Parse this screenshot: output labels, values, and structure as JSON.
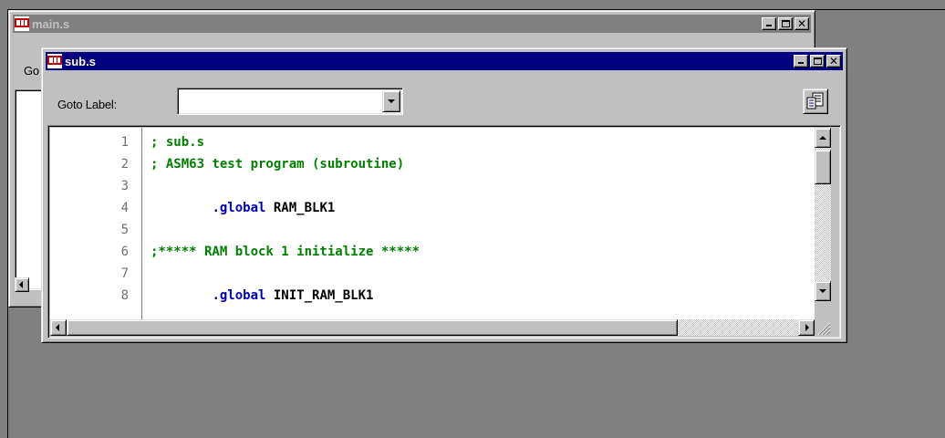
{
  "main_window": {
    "title": "main.s",
    "goto_label_truncated": "Go"
  },
  "sub_window": {
    "title": "sub.s",
    "goto_label": "Goto Label:",
    "goto_value": "",
    "code_lines": [
      {
        "num": "1",
        "segments": [
          {
            "text": "; sub.s",
            "kind": "comment"
          }
        ]
      },
      {
        "num": "2",
        "segments": [
          {
            "text": "; ASM63 test program (subroutine)",
            "kind": "comment"
          }
        ]
      },
      {
        "num": "3",
        "segments": []
      },
      {
        "num": "4",
        "segments": [
          {
            "text": "        ",
            "kind": "text"
          },
          {
            "text": ".global",
            "kind": "directive"
          },
          {
            "text": " RAM_BLK1",
            "kind": "text"
          }
        ]
      },
      {
        "num": "5",
        "segments": []
      },
      {
        "num": "6",
        "segments": [
          {
            "text": ";***** RAM block 1 initialize *****",
            "kind": "comment"
          }
        ]
      },
      {
        "num": "7",
        "segments": []
      },
      {
        "num": "8",
        "segments": [
          {
            "text": "        ",
            "kind": "text"
          },
          {
            "text": ".global",
            "kind": "directive"
          },
          {
            "text": " INIT_RAM_BLK1",
            "kind": "text"
          }
        ]
      }
    ]
  },
  "colors": {
    "active_title": "#000080",
    "inactive_title": "#808080",
    "comment": "#008000",
    "directive": "#0000c0",
    "mdi_background": "#808080"
  },
  "icons": [
    "document-app-icon",
    "minimize-icon",
    "maximize-icon",
    "close-icon",
    "properties-icon",
    "dropdown-arrow-icon",
    "scroll-arrow-icon",
    "resize-grip-icon"
  ]
}
